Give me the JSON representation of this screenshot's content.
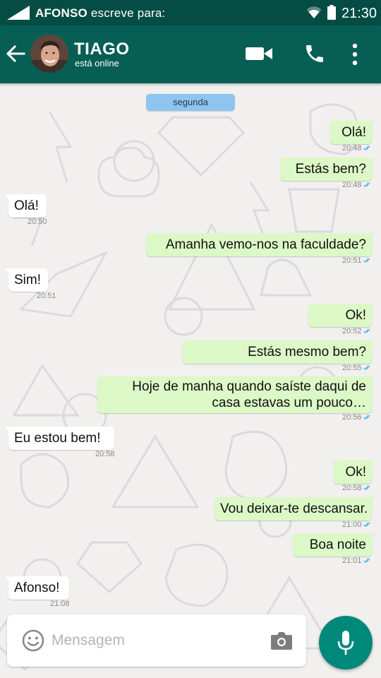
{
  "status_bar": {
    "notification": "AFONSO",
    "notification_suffix": " escreve para:",
    "time": "21:30"
  },
  "header": {
    "contact_name": "TIAGO",
    "contact_status": "está online",
    "icons": [
      "back-arrow-icon",
      "avatar",
      "videocam-icon",
      "phone-icon",
      "more-vert-icon"
    ]
  },
  "date_chip": "segunda",
  "messages": [
    {
      "direction": "out",
      "text": "Olá!",
      "time": "20:48",
      "read": true
    },
    {
      "direction": "out",
      "text": "Estás bem?",
      "time": "20:48",
      "read": true
    },
    {
      "direction": "in",
      "text": "Olá!",
      "time": "20:50"
    },
    {
      "direction": "out",
      "text": "Amanha vemo-nos na faculdade?",
      "time": "20:51",
      "read": true
    },
    {
      "direction": "in",
      "text": "Sim!",
      "time": "20:51"
    },
    {
      "direction": "out",
      "text": "Ok!",
      "time": "20:52",
      "read": true
    },
    {
      "direction": "out",
      "text": "Estás mesmo bem?",
      "time": "20:55",
      "read": true
    },
    {
      "direction": "out",
      "text": "Hoje de manha quando saíste daqui de casa estavas um pouco…",
      "time": "20:56",
      "read": true
    },
    {
      "direction": "in",
      "text": "Eu estou bem!",
      "time": "20:58"
    },
    {
      "direction": "out",
      "text": "Ok!",
      "time": "20:58",
      "read": true
    },
    {
      "direction": "out",
      "text": "Vou deixar-te descansar.",
      "time": "21:00",
      "read": true
    },
    {
      "direction": "out",
      "text": "Boa noite",
      "time": "21:01",
      "read": true
    },
    {
      "direction": "in",
      "text": "Afonso!",
      "time": "21:08"
    }
  ],
  "composer": {
    "placeholder": "Mensagem",
    "icons": [
      "emoji-icon",
      "camera-icon",
      "mic-icon"
    ]
  },
  "colors": {
    "status_bar": "#054d44",
    "app_bar": "#075e54",
    "outgoing_bubble": "#dcf8c6",
    "incoming_bubble": "#ffffff",
    "date_chip": "#8ec5f0",
    "read_tick": "#4fb6ec",
    "mic_button": "#00897b"
  }
}
